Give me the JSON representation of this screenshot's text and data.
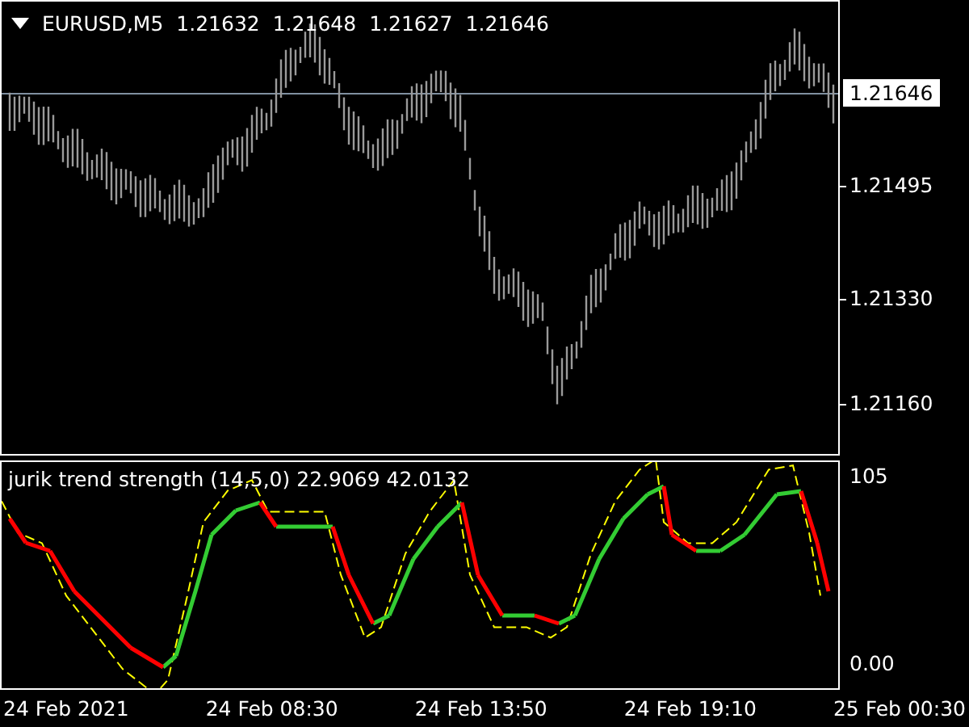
{
  "main_chart": {
    "header": {
      "symbol": "EURUSD,M5",
      "open": "1.21632",
      "high": "1.21648",
      "low": "1.21627",
      "close": "1.21646"
    },
    "price_axis": [
      "1.21495",
      "1.21330",
      "1.21160"
    ],
    "current_price": "1.21646"
  },
  "indicator": {
    "label": "jurik trend strength (14,5,0) 22.9069 42.0132",
    "axis": [
      "105",
      "0.00"
    ]
  },
  "time_axis": [
    "24 Feb 2021",
    "24 Feb 08:30",
    "24 Feb 13:50",
    "24 Feb 19:10",
    "25 Feb 00:30"
  ]
}
